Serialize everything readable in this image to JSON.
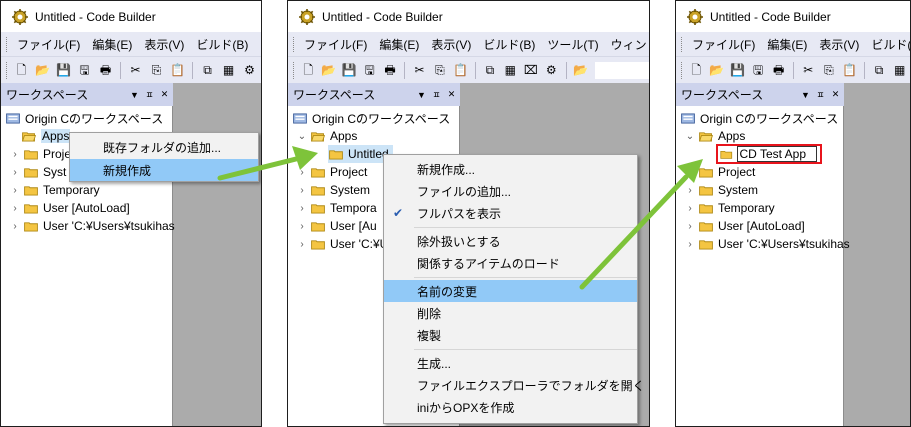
{
  "title_text": "Untitled - Code Builder",
  "menus": {
    "file": "ファイル(F)",
    "edit": "編集(E)",
    "view": "表示(V)",
    "build": "ビルド(B)",
    "tools": "ツール(T)",
    "window": "ウィンドウ",
    "build_short": "ツ",
    "window_short": "ウィンドウ"
  },
  "workspace": {
    "title": "ワークスペース",
    "dropdown": "▼",
    "pin": "ㅍ",
    "close": "✕",
    "root": "Origin Cのワークスペース"
  },
  "tree": {
    "apps": "Apps",
    "project": "Project",
    "system": "System",
    "temporary": "Temporary",
    "user_autoload": "User [AutoLoad]",
    "user_path": "User 'C:¥Users¥tsukihas",
    "project_cut": "Proje",
    "system_cut": "Syst",
    "temporary_cut": "Tempora",
    "user_autoload_cut": "User [Au",
    "user_path_cut": "User 'C:¥U",
    "untitled": "Untitled",
    "new_folder_name": "CD Test App"
  },
  "menu1": {
    "add_existing": "既存フォルダの追加...",
    "new_create": "新規作成"
  },
  "menu2": {
    "new": "新規作成...",
    "add_file": "ファイルの追加...",
    "full_path": "フルパスを表示",
    "check": "✔",
    "exclude": "除外扱いとする",
    "load_related": "関係するアイテムのロード",
    "rename": "名前の変更",
    "delete": "削除",
    "duplicate": "複製",
    "build": "生成...",
    "open_explorer": "ファイルエクスプローラでフォルダを開く",
    "create_opx": "iniからOPXを作成"
  },
  "colors": {
    "menubar_bg": "#e7e9f4",
    "header_bg": "#cdd3ec",
    "highlight": "#91c9f7",
    "arrow": "#7ec33a",
    "focus_box": "#e8141c"
  }
}
